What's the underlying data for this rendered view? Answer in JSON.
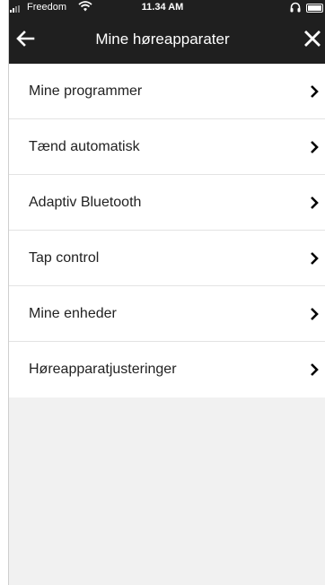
{
  "status_bar": {
    "carrier": "Freedom",
    "time": "11.34 AM"
  },
  "header": {
    "title": "Mine høreapparater",
    "back_icon": "back-arrow-icon",
    "close_icon": "close-icon"
  },
  "menu": {
    "items": [
      {
        "label": "Mine programmer",
        "icon": "chevron-right-icon"
      },
      {
        "label": "Tænd automatisk",
        "icon": "chevron-right-icon"
      },
      {
        "label": "Adaptiv Bluetooth",
        "icon": "chevron-right-icon"
      },
      {
        "label": "Tap control",
        "icon": "chevron-right-icon"
      },
      {
        "label": "Mine enheder",
        "icon": "chevron-right-icon"
      },
      {
        "label": "Høreapparatjusteringer",
        "icon": "chevron-right-icon"
      }
    ]
  },
  "colors": {
    "header_bg": "#1f1f1f",
    "page_bg": "#f1f1f1",
    "menu_bg": "#ffffff"
  }
}
